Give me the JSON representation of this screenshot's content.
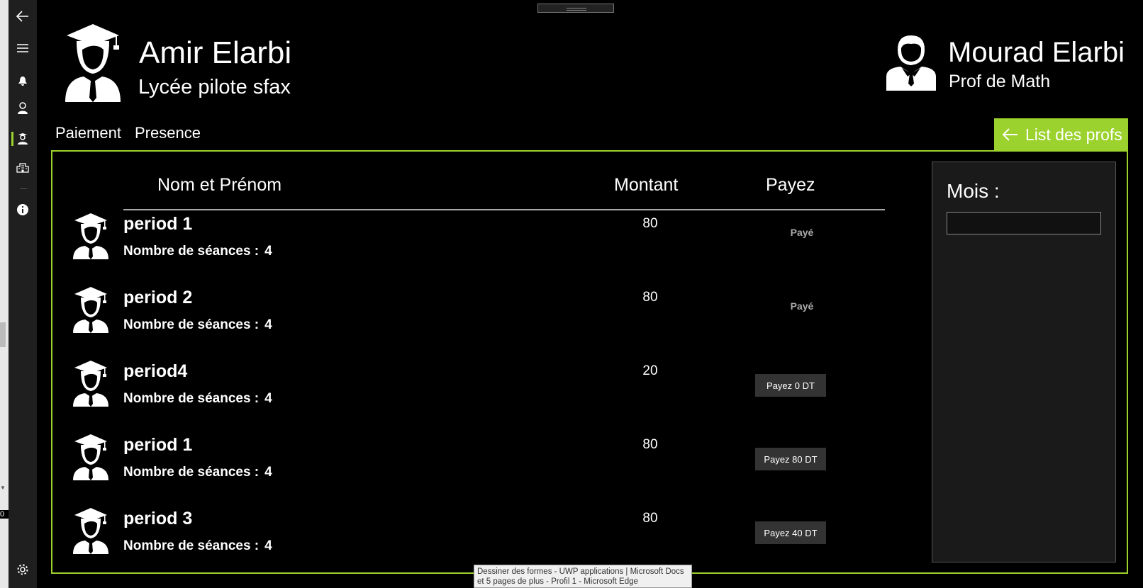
{
  "header": {
    "student_name": "Amir Elarbi",
    "school_name": "Lycée pilote sfax",
    "prof_name": "Mourad Elarbi",
    "prof_subject": "Prof de Math"
  },
  "tabs": [
    {
      "label": "Paiement"
    },
    {
      "label": "Presence"
    }
  ],
  "back_button": {
    "label": "List des profs"
  },
  "table": {
    "columns": [
      "Nom et Prénom",
      "Montant",
      "Payez"
    ],
    "rows": [
      {
        "period": "period 1",
        "seances_label": "Nombre de séances :",
        "seances": "4",
        "montant": "80",
        "payez": "Payé",
        "is_paid": true
      },
      {
        "period": "period 2",
        "seances_label": "Nombre de séances :",
        "seances": "4",
        "montant": "80",
        "payez": "Payé",
        "is_paid": true
      },
      {
        "period": "period4",
        "seances_label": "Nombre de séances :",
        "seances": "4",
        "montant": "20",
        "payez": "Payez 0 DT",
        "is_paid": false
      },
      {
        "period": "period 1",
        "seances_label": "Nombre de séances :",
        "seances": "4",
        "montant": "80",
        "payez": "Payez 80 DT",
        "is_paid": false
      },
      {
        "period": "period 3",
        "seances_label": "Nombre de séances :",
        "seances": "4",
        "montant": "80",
        "payez": "Payez 40 DT",
        "is_paid": false
      }
    ]
  },
  "side_panel": {
    "mois_label": "Mois :",
    "mois_value": ""
  },
  "tooltip": {
    "line1": "Dessiner des formes - UWP applications | Microsoft Docs",
    "line2": "et 5 pages de plus - Profil 1 - Microsoft Edge"
  },
  "left_strip": {
    "text": "0"
  },
  "colors": {
    "accent": "#9bd22d",
    "background": "#000000",
    "nav_rail": "#1f1f1f",
    "button": "#333333"
  },
  "nav_icons": [
    "back-arrow-icon",
    "hamburger-icon",
    "bell-icon",
    "teacher-icon",
    "student-icon",
    "building-icon",
    "info-icon",
    "settings-icon"
  ]
}
